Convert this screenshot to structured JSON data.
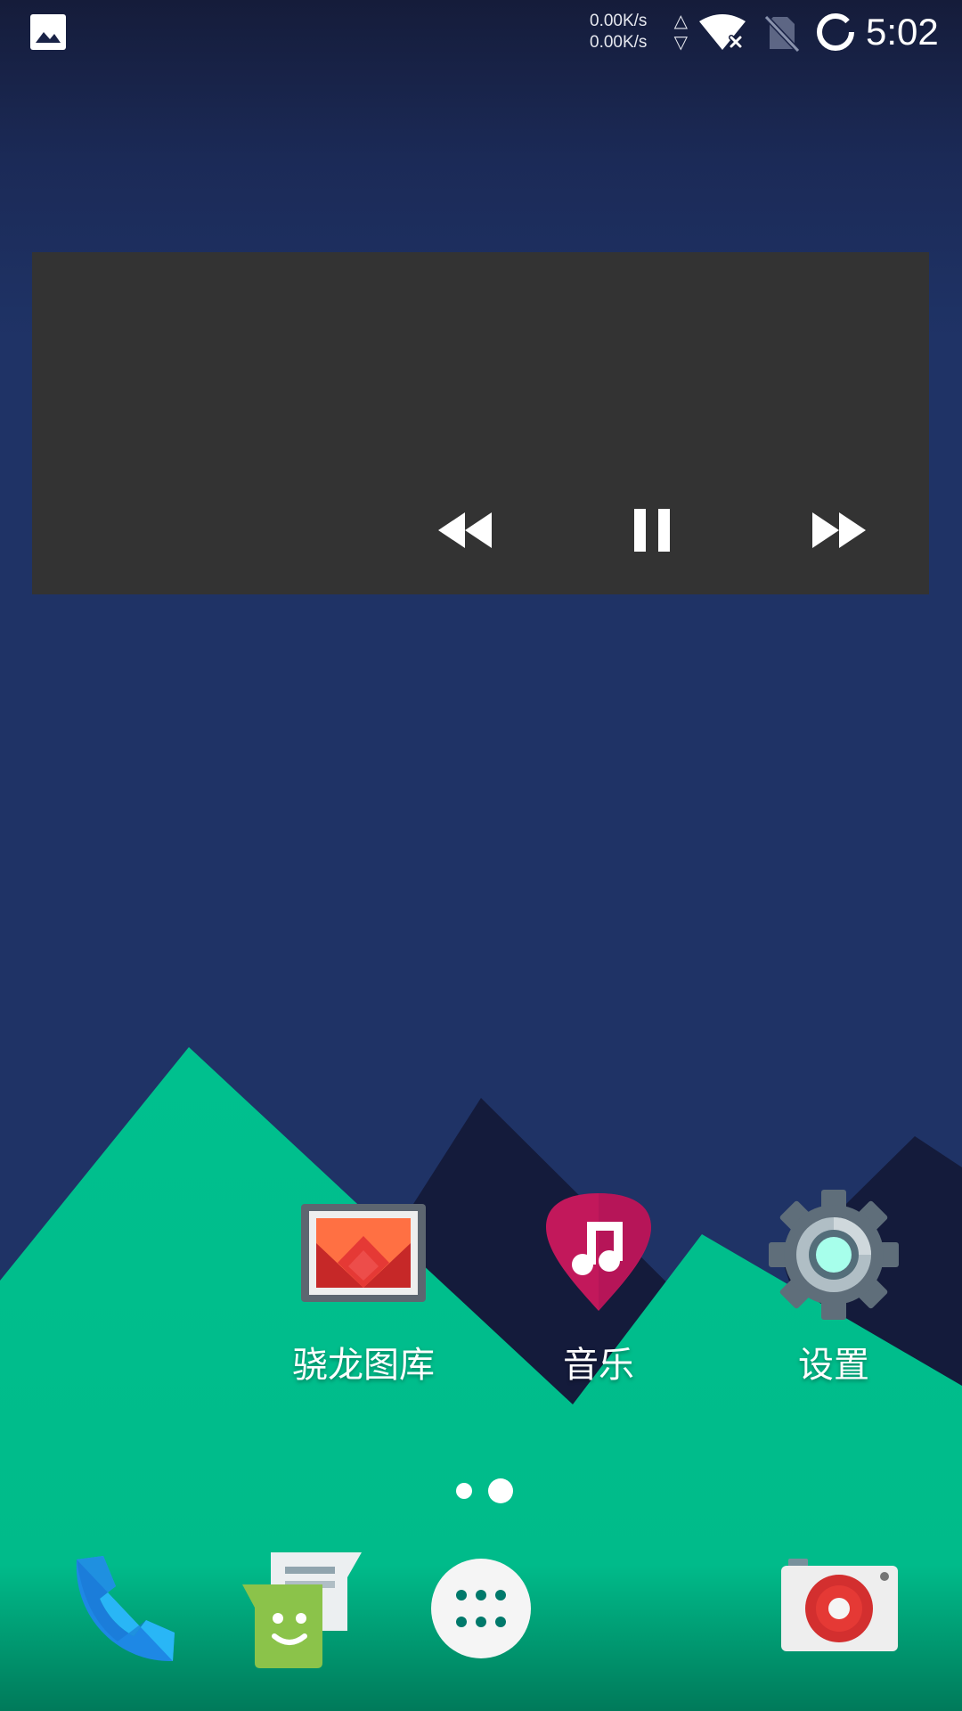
{
  "status_bar": {
    "upload_speed": "0.00K/s",
    "download_speed": "0.00K/s",
    "upload_arrow": "△",
    "download_arrow": "▽",
    "time": "5:02",
    "icons": [
      "gallery-notification-icon",
      "wifi-no-internet-icon",
      "no-sim-icon",
      "battery-loading-icon"
    ]
  },
  "music_widget": {
    "controls": [
      "previous-icon",
      "pause-icon",
      "next-icon"
    ]
  },
  "apps": [
    {
      "label": "骁龙图库",
      "icon": "gallery-icon"
    },
    {
      "label": "音乐",
      "icon": "music-icon"
    },
    {
      "label": "设置",
      "icon": "settings-gear-icon"
    }
  ],
  "page_indicator": {
    "pages": 2,
    "current": 2
  },
  "dock": [
    {
      "icon": "phone-icon"
    },
    {
      "icon": "messaging-icon"
    },
    {
      "icon": "app-drawer-icon"
    },
    {
      "icon": "camera-icon"
    }
  ],
  "colors": {
    "wallpaper_sky": "#1f3366",
    "wallpaper_green": "#00bf8c",
    "wallpaper_mountain_dark": "#141b3b",
    "widget_bg": "#333333"
  }
}
